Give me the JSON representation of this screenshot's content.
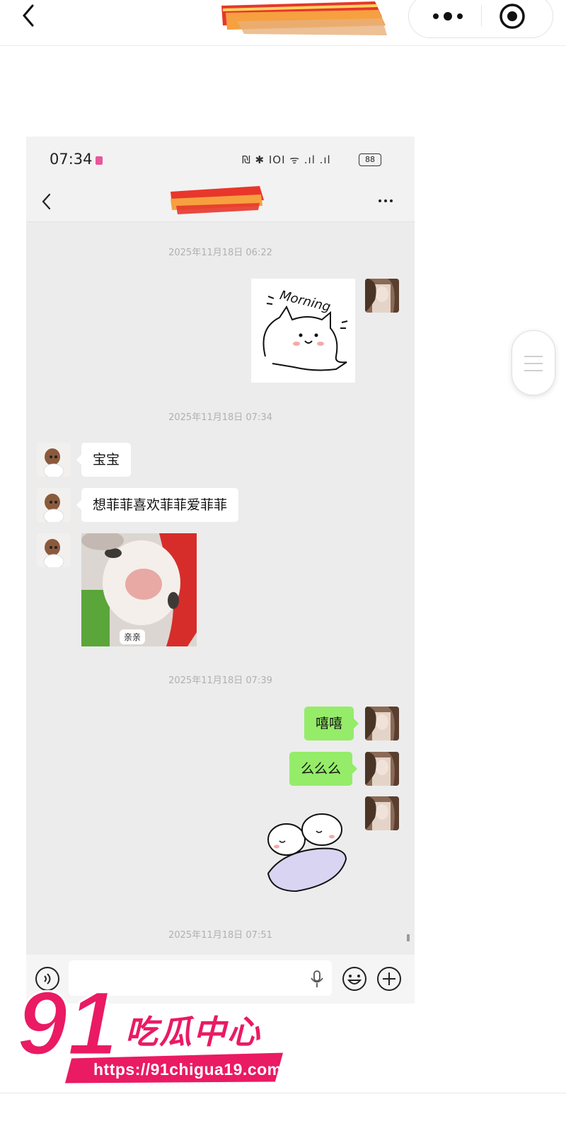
{
  "shot": {
    "status": {
      "time": "07:34",
      "icons_text": "₪ ✱ ⅠOⅠ ᯤ .ıl .ıl",
      "battery": "88"
    },
    "messages": {
      "ts1": "2025年11月18日 06:22",
      "ts2": "2025年11月18日 07:34",
      "bubble1": "宝宝",
      "bubble2": "想菲菲喜欢菲菲爱菲菲",
      "cat_label": "亲亲",
      "ts3": "2025年11月18日 07:39",
      "bubble3": "嘻嘻",
      "bubble4": "么么么",
      "ts4": "2025年11月18日 07:51"
    },
    "sticker_morning_text": "Morning"
  },
  "watermark": {
    "number": "91",
    "title": "吃瓜中心",
    "url": "https://91chigua19.com"
  },
  "colors": {
    "green_bubble": "#95ec69",
    "brand_pink": "#ea1a63",
    "chat_bg": "#ececec"
  },
  "icons": [
    "chevron-left-icon",
    "more-dots-icon",
    "record-target-icon",
    "voice-icon",
    "mic-icon",
    "emoji-icon",
    "plus-icon",
    "menu-lines-icon"
  ]
}
